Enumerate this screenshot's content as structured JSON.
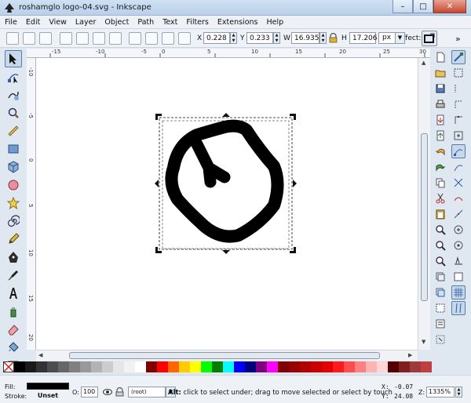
{
  "window": {
    "title": "roshamglo logo-04.svg - Inkscape",
    "min_glyph": "–",
    "max_glyph": "□",
    "close_glyph": "✕"
  },
  "menu": [
    "File",
    "Edit",
    "View",
    "Layer",
    "Object",
    "Path",
    "Text",
    "Filters",
    "Extensions",
    "Help"
  ],
  "tool_controls": {
    "x_label": "X",
    "x_value": "0.228",
    "y_label": "Y",
    "y_value": "0.233",
    "w_label": "W",
    "w_value": "16.935",
    "h_label": "H",
    "h_value": "17.206",
    "unit": "px",
    "affect_label": "Affect:",
    "overflow": "»"
  },
  "ruler_h": [
    {
      "label": "-15"
    },
    {
      "label": "-10"
    },
    {
      "label": "-5"
    },
    {
      "label": "0"
    },
    {
      "label": "5"
    },
    {
      "label": "10"
    },
    {
      "label": "15"
    },
    {
      "label": "20"
    },
    {
      "label": "25"
    },
    {
      "label": "30"
    }
  ],
  "ruler_v": [
    {
      "label": "-10"
    },
    {
      "label": "-5"
    },
    {
      "label": "0"
    },
    {
      "label": "5"
    },
    {
      "label": "10"
    },
    {
      "label": "15"
    },
    {
      "label": "20"
    }
  ],
  "statusbar": {
    "fill_label": "Fill:",
    "stroke_label": "Stroke:",
    "stroke_value": "Unset",
    "opacity_label": "O:",
    "opacity_value": "100",
    "layer": "(root)",
    "message_bold": "Alt:",
    "message": " click to select under; drag to move selected or select by touch",
    "x_label": "X:",
    "x_value": "-0.07",
    "y_label": "Y:",
    "y_value": "24.08",
    "zoom_label": "Z:",
    "zoom_value": "1335%"
  },
  "palette": [
    "#000000",
    "#1a1a1a",
    "#333333",
    "#4d4d4d",
    "#666666",
    "#808080",
    "#999999",
    "#b3b3b3",
    "#cccccc",
    "#e6e6e6",
    "#f2f2f2",
    "#ffffff",
    "#800000",
    "#ff0000",
    "#ff6600",
    "#ffcc00",
    "#ffff00",
    "#00ff00",
    "#008000",
    "#00ffff",
    "#0000ff",
    "#000080",
    "#800080",
    "#ff00ff",
    "#800000",
    "#990000",
    "#b30000",
    "#cc0000",
    "#e60000",
    "#ff1a1a",
    "#ff4d4d",
    "#ff8080",
    "#ffb3b3",
    "#ffd5d5",
    "#550000",
    "#7f1f1f",
    "#a03a3a",
    "#c04040"
  ]
}
